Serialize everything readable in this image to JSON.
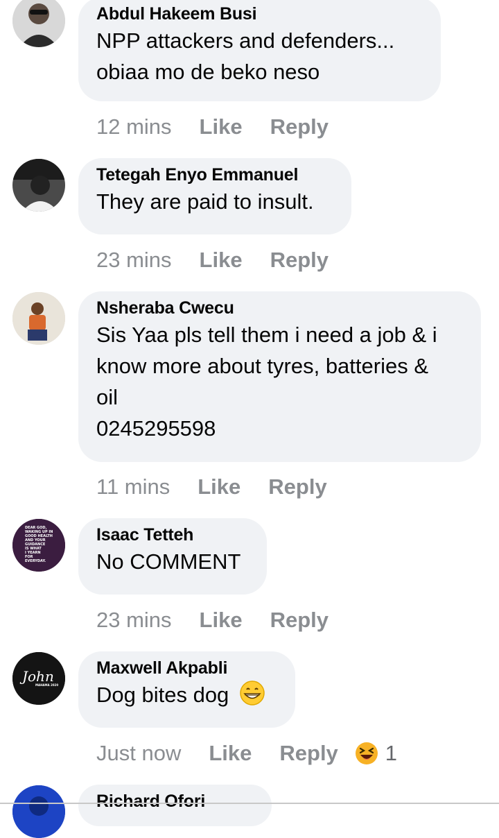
{
  "comments": [
    {
      "author": "Abdul Hakeem Busi",
      "text_lines": [
        "NPP attackers and defenders...",
        "obiaa mo de beko neso"
      ],
      "time": "12 mins",
      "like": "Like",
      "reply": "Reply"
    },
    {
      "author": "Tetegah Enyo Emmanuel",
      "text_lines": [
        "They are paid to insult."
      ],
      "time": "23 mins",
      "like": "Like",
      "reply": "Reply"
    },
    {
      "author": "Nsheraba Cwecu",
      "text_lines": [
        "Sis Yaa pls tell them i need a job & i",
        "know more about tyres, batteries &",
        "oil",
        "0245295598"
      ],
      "time": "11 mins",
      "like": "Like",
      "reply": "Reply"
    },
    {
      "author": "Isaac Tetteh",
      "text_lines": [
        "No COMMENT"
      ],
      "avatar_text": [
        "DEAR GOD,",
        "WAKING UP IN",
        "GOOD HEALTH",
        "AND YOUR",
        "GUIDANCE",
        "IS WHAT",
        "I YEARN",
        "FOR",
        "EVERYDAY."
      ],
      "time": "23 mins",
      "like": "Like",
      "reply": "Reply"
    },
    {
      "author": "Maxwell Akpabli",
      "text_lines": [
        "Dog bites dog"
      ],
      "text_emoji": "grinning-face-emoji",
      "avatar_text": [
        "John",
        "MAHAMA 2020"
      ],
      "time": "Just now",
      "like": "Like",
      "reply": "Reply",
      "reaction_icon": "haha-reaction-icon",
      "reaction_count": "1"
    },
    {
      "author": "Richard Ofori"
    }
  ],
  "colors": {
    "bubble": "#f0f2f5",
    "text": "#050505",
    "meta": "#8a8d91",
    "reaction": "#f7b125"
  }
}
